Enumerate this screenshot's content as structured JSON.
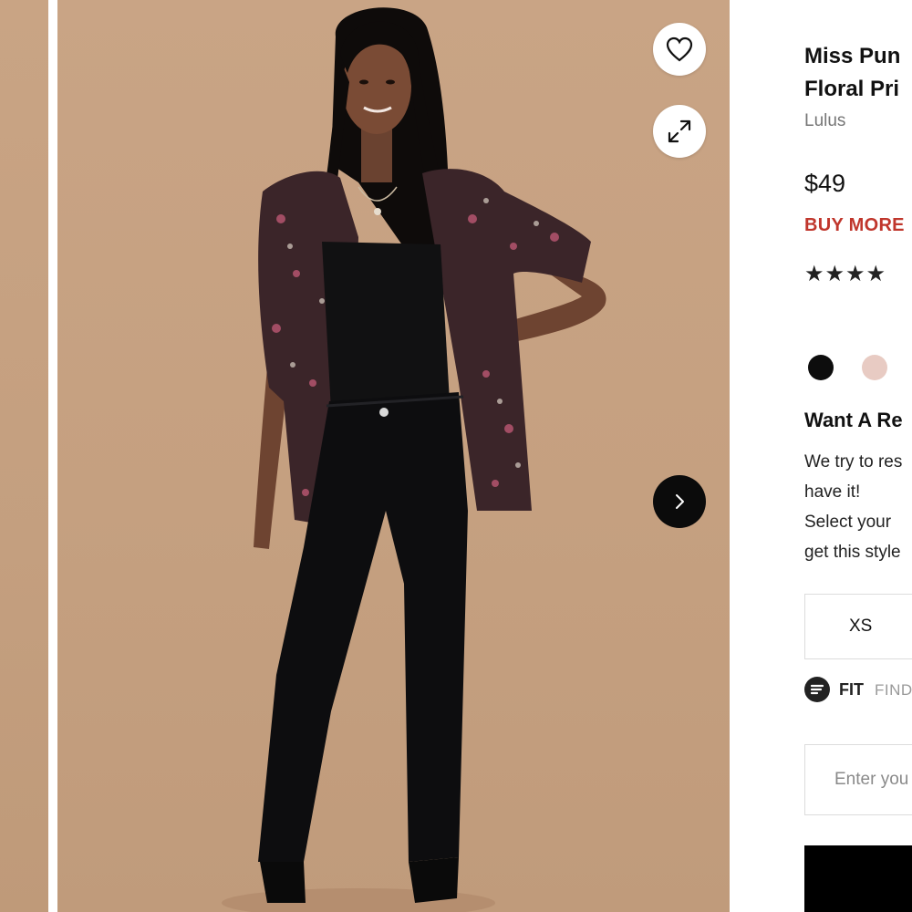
{
  "gallery": {
    "prev_image_alt": "previous product photo",
    "main_image_alt": "model wearing floral print kimono jacket over black bodysuit and black skinny jeans",
    "favorite_icon": "heart-icon",
    "expand_icon": "expand-icon",
    "next_icon": "chevron-right-icon"
  },
  "product": {
    "title_line1": "Miss Pun",
    "title_line2": "Floral Pri",
    "brand": "Lulus",
    "price": "$49",
    "promo": "BUY MORE",
    "rating_stars": "★★★★"
  },
  "colors": {
    "swatches": [
      {
        "name": "black",
        "hex": "#0d0d0d"
      },
      {
        "name": "blush",
        "hex": "#e8cbc3"
      }
    ],
    "accent_red": "#c0362c"
  },
  "restock": {
    "heading": "Want A Re",
    "line1": "We try to res",
    "line2": "have it!",
    "line3": "Select your",
    "line4": "get this style"
  },
  "sizes": [
    {
      "label": "XS"
    }
  ],
  "fit_finder": {
    "bold": "FIT",
    "light": "FIND"
  },
  "email": {
    "placeholder": "Enter you"
  }
}
